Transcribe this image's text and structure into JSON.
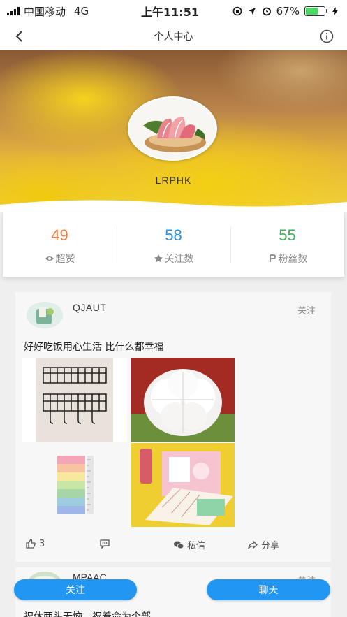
{
  "status_bar": {
    "carrier": "中国移动",
    "network": "4G",
    "time": "上午11:51",
    "battery": "67%",
    "battery_level": 0.67
  },
  "nav": {
    "title": "个人中心",
    "back_icon": "chevron-left-icon",
    "info_icon": "info-circle-icon"
  },
  "profile": {
    "username": "LRPHK"
  },
  "stats": [
    {
      "value": "49",
      "label": "超赞",
      "icon": "eye-icon",
      "color": "#f07a3a"
    },
    {
      "value": "58",
      "label": "关注数",
      "icon": "star-icon",
      "color": "#2a8fe0"
    },
    {
      "value": "55",
      "label": "粉丝数",
      "icon": "person-icon",
      "color": "#3fae5c"
    }
  ],
  "post": {
    "user": "QJAUT",
    "follow": "关注",
    "text": "好好吃饭用心生活 比什么都幸福",
    "likes": "3",
    "message": "私信",
    "share": "分享"
  },
  "post2": {
    "user": "MPAAC",
    "follow": "关注",
    "text": "祝休两头无恼，祝着命为个部"
  },
  "buttons": {
    "follow": "关注",
    "chat": "聊天"
  },
  "colors": {
    "accent": "#2196f3"
  }
}
